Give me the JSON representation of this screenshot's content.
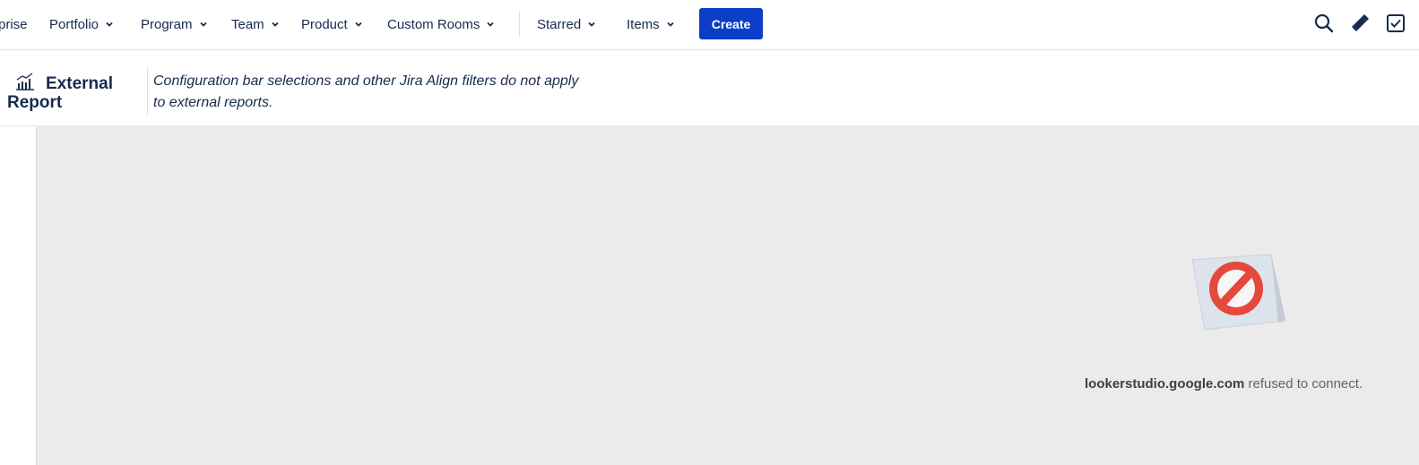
{
  "nav": {
    "items": [
      {
        "label": "prise"
      },
      {
        "label": "Portfolio"
      },
      {
        "label": "Program"
      },
      {
        "label": "Team"
      },
      {
        "label": "Product"
      },
      {
        "label": "Custom Rooms"
      },
      {
        "label": "Starred"
      },
      {
        "label": "Items"
      }
    ],
    "create_label": "Create",
    "icons": [
      "search-icon",
      "megaphone-icon",
      "checkbox-icon"
    ]
  },
  "header": {
    "title_line1": "External",
    "title_line2": "Report",
    "note": "Configuration bar selections and other Jira Align filters do not apply to external reports.",
    "icon": "chart-icon"
  },
  "frame": {
    "domain": "lookerstudio.google.com",
    "message": "refused to connect.",
    "icon": "blocked-icon"
  },
  "colors": {
    "primary": "#0c3dc6",
    "text": "#172b4d",
    "frame_bg": "#ebebeb",
    "error_red": "#e5483c"
  }
}
